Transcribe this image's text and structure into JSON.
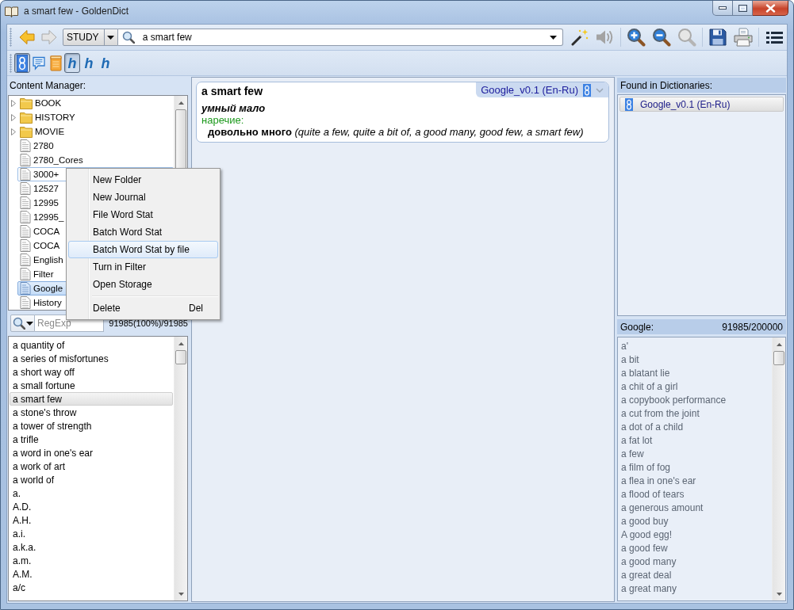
{
  "window": {
    "title": "a smart few - GoldenDict"
  },
  "toolbar": {
    "navigation": [
      {
        "kind": "back",
        "disabled": false
      },
      {
        "kind": "forward",
        "disabled": true
      }
    ],
    "group": "STUDY",
    "search": {
      "value": "a smart few"
    },
    "groups": [
      [
        {
          "kind": "wand",
          "disabled": false
        },
        {
          "kind": "speaker",
          "disabled": true
        }
      ],
      [
        {
          "kind": "zoom-in",
          "disabled": false
        },
        {
          "kind": "zoom-out",
          "disabled": false
        },
        {
          "kind": "zoom-reset",
          "disabled": true
        }
      ],
      [
        {
          "kind": "save",
          "disabled": false
        },
        {
          "kind": "print",
          "disabled": false
        }
      ],
      [
        {
          "kind": "menu",
          "disabled": false
        }
      ]
    ]
  },
  "dictionary_bar": [
    {
      "kind": "tile",
      "selected": true
    },
    {
      "kind": "chat",
      "selected": false
    },
    {
      "kind": "notebook",
      "selected": false
    },
    {
      "kind": "letter",
      "text": "h",
      "selected": true
    },
    {
      "kind": "letter",
      "text": "h",
      "selected": false
    },
    {
      "kind": "letter",
      "text": "h",
      "selected": false
    }
  ],
  "content_manager": {
    "title": "Content Manager:",
    "items": [
      {
        "kind": "folder",
        "label": "BOOK",
        "expanded": false,
        "selected": false,
        "focused": false
      },
      {
        "kind": "folder",
        "label": "HISTORY",
        "expanded": false,
        "selected": false,
        "focused": false
      },
      {
        "kind": "folder",
        "label": "MOVIE",
        "expanded": false,
        "selected": false,
        "focused": false
      },
      {
        "kind": "document",
        "label": "2780",
        "selected": false,
        "focused": false
      },
      {
        "kind": "document",
        "label": "2780_Cores",
        "selected": false,
        "focused": false
      },
      {
        "kind": "document",
        "label": "3000+",
        "selected": false,
        "focused": true
      },
      {
        "kind": "document",
        "label": "12527",
        "selected": false,
        "focused": false
      },
      {
        "kind": "document",
        "label": "12995",
        "selected": false,
        "focused": false
      },
      {
        "kind": "document",
        "label": "12995_",
        "selected": false,
        "focused": false
      },
      {
        "kind": "document",
        "label": "COCA",
        "selected": false,
        "focused": false
      },
      {
        "kind": "document",
        "label": "COCA",
        "selected": false,
        "focused": false
      },
      {
        "kind": "document",
        "label": "English",
        "selected": false,
        "focused": false
      },
      {
        "kind": "document",
        "label": "Filter",
        "selected": false,
        "focused": false
      },
      {
        "kind": "document",
        "label": "Google",
        "selected": true,
        "focused": false
      },
      {
        "kind": "document",
        "label": "History",
        "selected": false,
        "focused": false
      }
    ]
  },
  "context_menu": [
    {
      "kind": "item",
      "label": "New Folder",
      "selected": false
    },
    {
      "kind": "item",
      "label": "New Journal",
      "selected": false
    },
    {
      "kind": "item",
      "label": "File Word Stat",
      "selected": false
    },
    {
      "kind": "item",
      "label": "Batch Word Stat",
      "selected": false
    },
    {
      "kind": "item",
      "label": "Batch Word Stat by file",
      "selected": true
    },
    {
      "kind": "item",
      "label": "Turn in Filter",
      "selected": false
    },
    {
      "kind": "item",
      "label": "Open Storage",
      "selected": false
    },
    {
      "kind": "separator"
    },
    {
      "kind": "item",
      "label": "Delete",
      "shortcut": "Del",
      "selected": false
    }
  ],
  "filter": {
    "placeholder": "RegExp",
    "count": "91985(100%)/91985"
  },
  "word_list": [
    {
      "label": "a quantity of",
      "selected": false
    },
    {
      "label": "a series of misfortunes",
      "selected": false
    },
    {
      "label": "a short way off",
      "selected": false
    },
    {
      "label": "a small fortune",
      "selected": false
    },
    {
      "label": "a smart few",
      "selected": true
    },
    {
      "label": "a stone's throw",
      "selected": false
    },
    {
      "label": "a tower of strength",
      "selected": false
    },
    {
      "label": "a trifle",
      "selected": false
    },
    {
      "label": "a word in one's ear",
      "selected": false
    },
    {
      "label": "a work of art",
      "selected": false
    },
    {
      "label": "a world of",
      "selected": false
    },
    {
      "label": "a.",
      "selected": false
    },
    {
      "label": "A.D.",
      "selected": false
    },
    {
      "label": "A.H.",
      "selected": false
    },
    {
      "label": "a.i.",
      "selected": false
    },
    {
      "label": "a.k.a.",
      "selected": false
    },
    {
      "label": "a.m.",
      "selected": false
    },
    {
      "label": "A.M.",
      "selected": false
    },
    {
      "label": "a/c",
      "selected": false
    }
  ],
  "article": {
    "headword": "a smart few",
    "dictionary": "Google_v0.1 (En-Ru)",
    "translation": "умный мало",
    "part_of_speech": "наречие:",
    "definition": "**довольно много** *(quite a few, quite a bit of, a good many, good few, a smart few)*"
  },
  "found_in_dictionaries": {
    "title": "Found in Dictionaries:",
    "items": [
      {
        "label": "Google_v0.1 (En-Ru)",
        "selected": true
      }
    ]
  },
  "dictionary_words": {
    "title": "Google:",
    "count": "91985/200000",
    "items": [
      "a'",
      "a bit",
      "a blatant lie",
      "a chit of a girl",
      "a copybook performance",
      "a cut from the joint",
      "a dot of a child",
      "a fat lot",
      "a few",
      "a film of fog",
      "a flea in one's ear",
      "a flood of tears",
      "a generous amount",
      "a good buy",
      "A good egg!",
      "a good few",
      "a good many",
      "a great deal",
      "a great many"
    ]
  }
}
